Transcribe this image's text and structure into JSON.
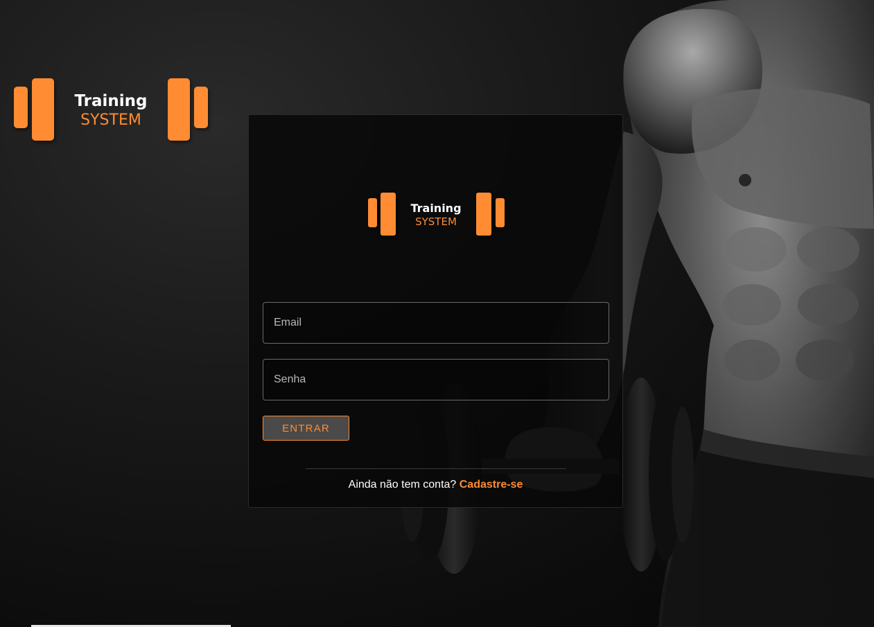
{
  "brand": {
    "line1": "Training",
    "line2": "SYSTEM",
    "accent_color": "#ff8c33"
  },
  "login": {
    "email_placeholder": "Email",
    "password_placeholder": "Senha",
    "submit_label": "ENTRAR",
    "signup_prompt": "Ainda não tem conta?",
    "signup_link": "Cadastre-se"
  }
}
